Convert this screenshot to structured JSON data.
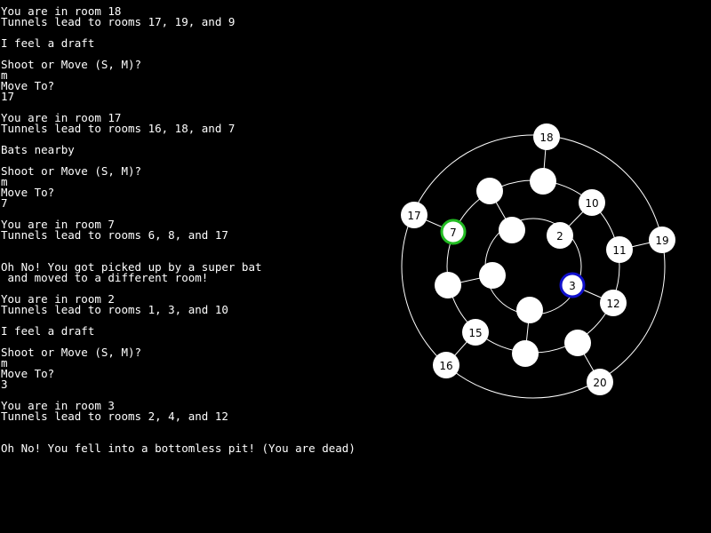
{
  "console": {
    "lines": [
      "You are in room 18",
      "Tunnels lead to rooms 17, 19, and 9",
      "",
      "I feel a draft",
      "",
      "Shoot or Move (S, M)?",
      "m",
      "Move To?",
      "17",
      "",
      "You are in room 17",
      "Tunnels lead to rooms 16, 18, and 7",
      "",
      "Bats nearby",
      "",
      "Shoot or Move (S, M)?",
      "m",
      "Move To?",
      "7",
      "",
      "You are in room 7",
      "Tunnels lead to rooms 6, 8, and 17",
      "",
      "",
      "Oh No! You got picked up by a super bat",
      " and moved to a different room!",
      "",
      "You are in room 2",
      "Tunnels lead to rooms 1, 3, and 10",
      "",
      "I feel a draft",
      "",
      "Shoot or Move (S, M)?",
      "m",
      "Move To?",
      "3",
      "",
      "You are in room 3",
      "Tunnels lead to rooms 2, 4, and 12",
      "",
      "",
      "Oh No! You fell into a bottomless pit! (You are dead)"
    ]
  },
  "map": {
    "colors": {
      "background": "#000000",
      "ring": "#ffffff",
      "room_fill": "#ffffff",
      "label": "#000000",
      "visited_outline": "#22bb22",
      "current_outline": "#1010cc"
    },
    "rooms": [
      {
        "id": "18",
        "label": "18",
        "highlight": ""
      },
      {
        "id": "19",
        "label": "19",
        "highlight": ""
      },
      {
        "id": "20",
        "label": "20",
        "highlight": ""
      },
      {
        "id": "16",
        "label": "16",
        "highlight": ""
      },
      {
        "id": "17",
        "label": "17",
        "highlight": ""
      },
      {
        "id": "10",
        "label": "10",
        "highlight": ""
      },
      {
        "id": "11",
        "label": "11",
        "highlight": ""
      },
      {
        "id": "12",
        "label": "12",
        "highlight": ""
      },
      {
        "id": "13",
        "label": "",
        "highlight": ""
      },
      {
        "id": "14",
        "label": "",
        "highlight": ""
      },
      {
        "id": "15",
        "label": "15",
        "highlight": ""
      },
      {
        "id": "6",
        "label": "",
        "highlight": ""
      },
      {
        "id": "7",
        "label": "7",
        "highlight": "visited"
      },
      {
        "id": "8",
        "label": "",
        "highlight": ""
      },
      {
        "id": "9",
        "label": "",
        "highlight": ""
      },
      {
        "id": "2",
        "label": "2",
        "highlight": ""
      },
      {
        "id": "3",
        "label": "3",
        "highlight": "current"
      },
      {
        "id": "4",
        "label": "",
        "highlight": ""
      },
      {
        "id": "5",
        "label": "",
        "highlight": ""
      },
      {
        "id": "1",
        "label": "",
        "highlight": ""
      }
    ]
  }
}
